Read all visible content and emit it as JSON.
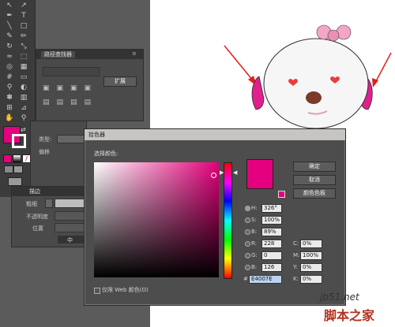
{
  "panel_transform": {
    "tab_label": "路径查找器",
    "expand_button": "扩展"
  },
  "panel_appearance": {
    "type_label": "类型:",
    "offset_label": "偏移"
  },
  "panel_stroke": {
    "tab_label": "描边",
    "weight_label": "粗细",
    "opacity_label": "不透明度",
    "position_label": "位置",
    "footer_label": "中"
  },
  "color_picker": {
    "title": "拾色器",
    "select_color_label": "选择颜色:",
    "ok_button": "确定",
    "cancel_button": "取消",
    "swatches_button": "颜色色板",
    "web_only_label": "仅限 Web 颜色(O)",
    "fields": {
      "h_label": "H:",
      "h_value": "326°",
      "s_label": "S:",
      "s_value": "100%",
      "b_label": "B:",
      "b_value": "89%",
      "r_label": "R:",
      "r_value": "228",
      "g_label": "G:",
      "g_value": "0",
      "b2_label": "B:",
      "b2_value": "126",
      "hash_label": "#",
      "hex_value": "E4007E",
      "c_label": "C:",
      "c_value": "0%",
      "m_label": "M:",
      "m_value": "100%",
      "y_label": "Y:",
      "y_value": "0%",
      "k_label": "K:",
      "k_value": "0%"
    }
  },
  "watermark": {
    "site": "jb51.net",
    "name": "脚本之家"
  },
  "colors": {
    "current": "#E4007E",
    "ear": "#E0208C",
    "bow": "#F3A6C7",
    "arrow": "#E0201E"
  }
}
